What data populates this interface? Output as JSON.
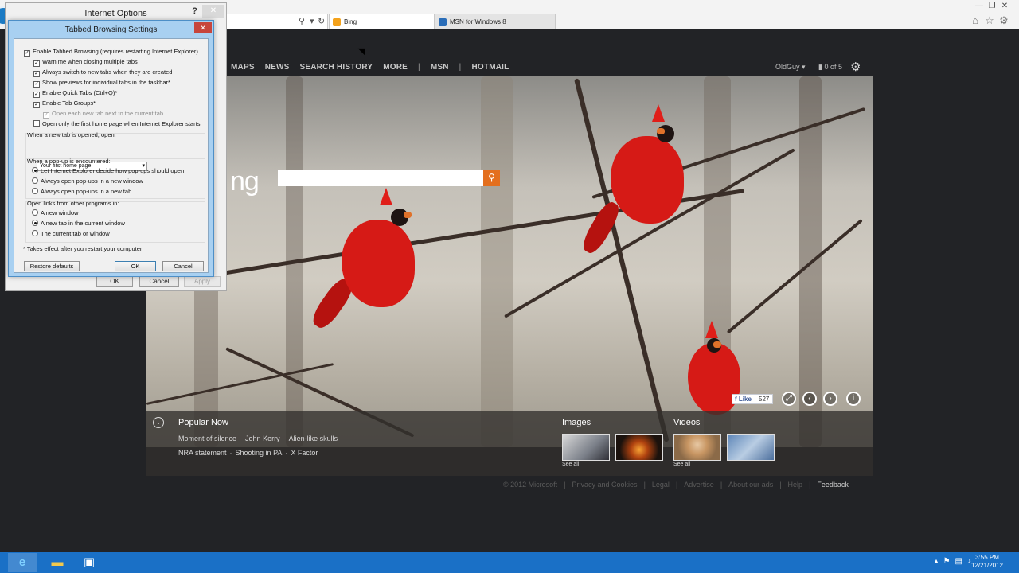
{
  "browser": {
    "address_value": "",
    "tabs": [
      {
        "label": "Bing"
      },
      {
        "label": "MSN for Windows 8"
      }
    ]
  },
  "bing": {
    "nav": [
      "MAPS",
      "NEWS",
      "SEARCH HISTORY",
      "MORE",
      "MSN",
      "HOTMAIL"
    ],
    "nav_separator": "|",
    "user": "OldGuy",
    "user_caret": "▾",
    "rewards": "0 of 5",
    "logo_fragment": "ng",
    "search_value": "",
    "like_label": "Like",
    "like_count": "527",
    "popular_now": {
      "title": "Popular Now",
      "line1": [
        "Moment of silence",
        "John Kerry",
        "Alien-like skulls"
      ],
      "line2": [
        "NRA statement",
        "Shooting in PA",
        "X Factor"
      ],
      "dot": "·"
    },
    "images_title": "Images",
    "videos_title": "Videos",
    "see_all": "See all",
    "footer": [
      "© 2012 Microsoft",
      "|",
      "Privacy and Cookies",
      "|",
      "Legal",
      "|",
      "Advertise",
      "|",
      "About our ads",
      "|",
      "Help",
      "|",
      "Feedback"
    ]
  },
  "internet_options": {
    "title": "Internet Options",
    "help": "?",
    "close": "✕",
    "ok": "OK",
    "cancel": "Cancel",
    "apply": "Apply"
  },
  "tabbed_settings": {
    "title": "Tabbed Browsing Settings",
    "close": "✕",
    "enable_tabbed": "Enable Tabbed Browsing (requires restarting Internet Explorer)",
    "options": [
      {
        "label": "Warn me when closing multiple tabs",
        "checked": true
      },
      {
        "label": "Always switch to new tabs when they are created",
        "checked": true
      },
      {
        "label": "Show previews for individual tabs in the taskbar*",
        "checked": true
      },
      {
        "label": "Enable Quick Tabs (Ctrl+Q)*",
        "checked": true
      },
      {
        "label": "Enable Tab Groups*",
        "checked": true
      },
      {
        "label": "Open each new tab next to the current tab",
        "checked": true,
        "disabled": true
      },
      {
        "label": "Open only the first home page when Internet Explorer starts",
        "checked": false
      }
    ],
    "new_tab_label": "When a new tab is opened, open:",
    "new_tab_value": "Your first home page",
    "popup_label": "When a pop-up is encountered:",
    "popup_options": [
      {
        "label": "Let Internet Explorer decide how pop-ups should open",
        "selected": true
      },
      {
        "label": "Always open pop-ups in a new window",
        "selected": false
      },
      {
        "label": "Always open pop-ups in a new tab",
        "selected": false
      }
    ],
    "links_label": "Open links from other programs in:",
    "links_options": [
      {
        "label": "A new window",
        "selected": false
      },
      {
        "label": "A new tab in the current window",
        "selected": true
      },
      {
        "label": "The current tab or window",
        "selected": false
      }
    ],
    "footnote": "* Takes effect after you restart your computer",
    "restore": "Restore defaults",
    "ok": "OK",
    "cancel": "Cancel"
  },
  "taskbar": {
    "time": "3:55 PM",
    "date": "12/21/2012"
  },
  "colors": {
    "bing_orange": "#e36f1e",
    "taskbar_blue": "#1a70c6",
    "dialog_frame": "#a8d0f1",
    "cardinal_red": "#d61a16"
  }
}
